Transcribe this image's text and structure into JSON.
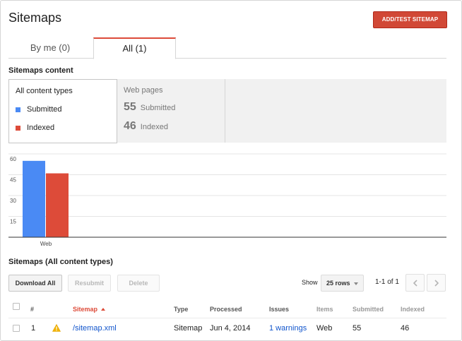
{
  "header": {
    "title": "Sitemaps",
    "add_button": "ADD/TEST SITEMAP"
  },
  "tabs": [
    {
      "label": "By me (0)",
      "active": false
    },
    {
      "label": "All (1)",
      "active": true
    }
  ],
  "content_section": {
    "heading": "Sitemaps content",
    "content_types_title": "All content types",
    "legend": [
      {
        "label": "Submitted",
        "color": "#4a8af4"
      },
      {
        "label": "Indexed",
        "color": "#dd4b39"
      }
    ],
    "web_pages": {
      "title": "Web pages",
      "submitted_count": "55",
      "submitted_label": "Submitted",
      "indexed_count": "46",
      "indexed_label": "Indexed"
    }
  },
  "chart_data": {
    "type": "bar",
    "categories": [
      "Web"
    ],
    "series": [
      {
        "name": "Submitted",
        "values": [
          55
        ],
        "color": "#4a8af4"
      },
      {
        "name": "Indexed",
        "values": [
          46
        ],
        "color": "#dd4b39"
      }
    ],
    "yticks": [
      "15",
      "30",
      "45",
      "60"
    ],
    "ylim": [
      0,
      60
    ],
    "grid": true,
    "legend": "none"
  },
  "table_section": {
    "heading": "Sitemaps (All content types)",
    "download_label": "Download All",
    "resubmit_label": "Resubmit",
    "delete_label": "Delete",
    "show_label": "Show",
    "rows_selected": "25 rows",
    "pager_label": "1-1 of 1",
    "columns": {
      "num": "#",
      "sitemap": "Sitemap",
      "type": "Type",
      "processed": "Processed",
      "issues": "Issues",
      "items": "Items",
      "submitted": "Submitted",
      "indexed": "Indexed"
    },
    "rows": [
      {
        "num": "1",
        "sitemap": "/sitemap.xml",
        "type": "Sitemap",
        "processed": "Jun 4, 2014",
        "issues": "1 warnings",
        "items": "Web",
        "submitted": "55",
        "indexed": "46"
      }
    ],
    "warning_icon": "warning-triangle-icon"
  }
}
